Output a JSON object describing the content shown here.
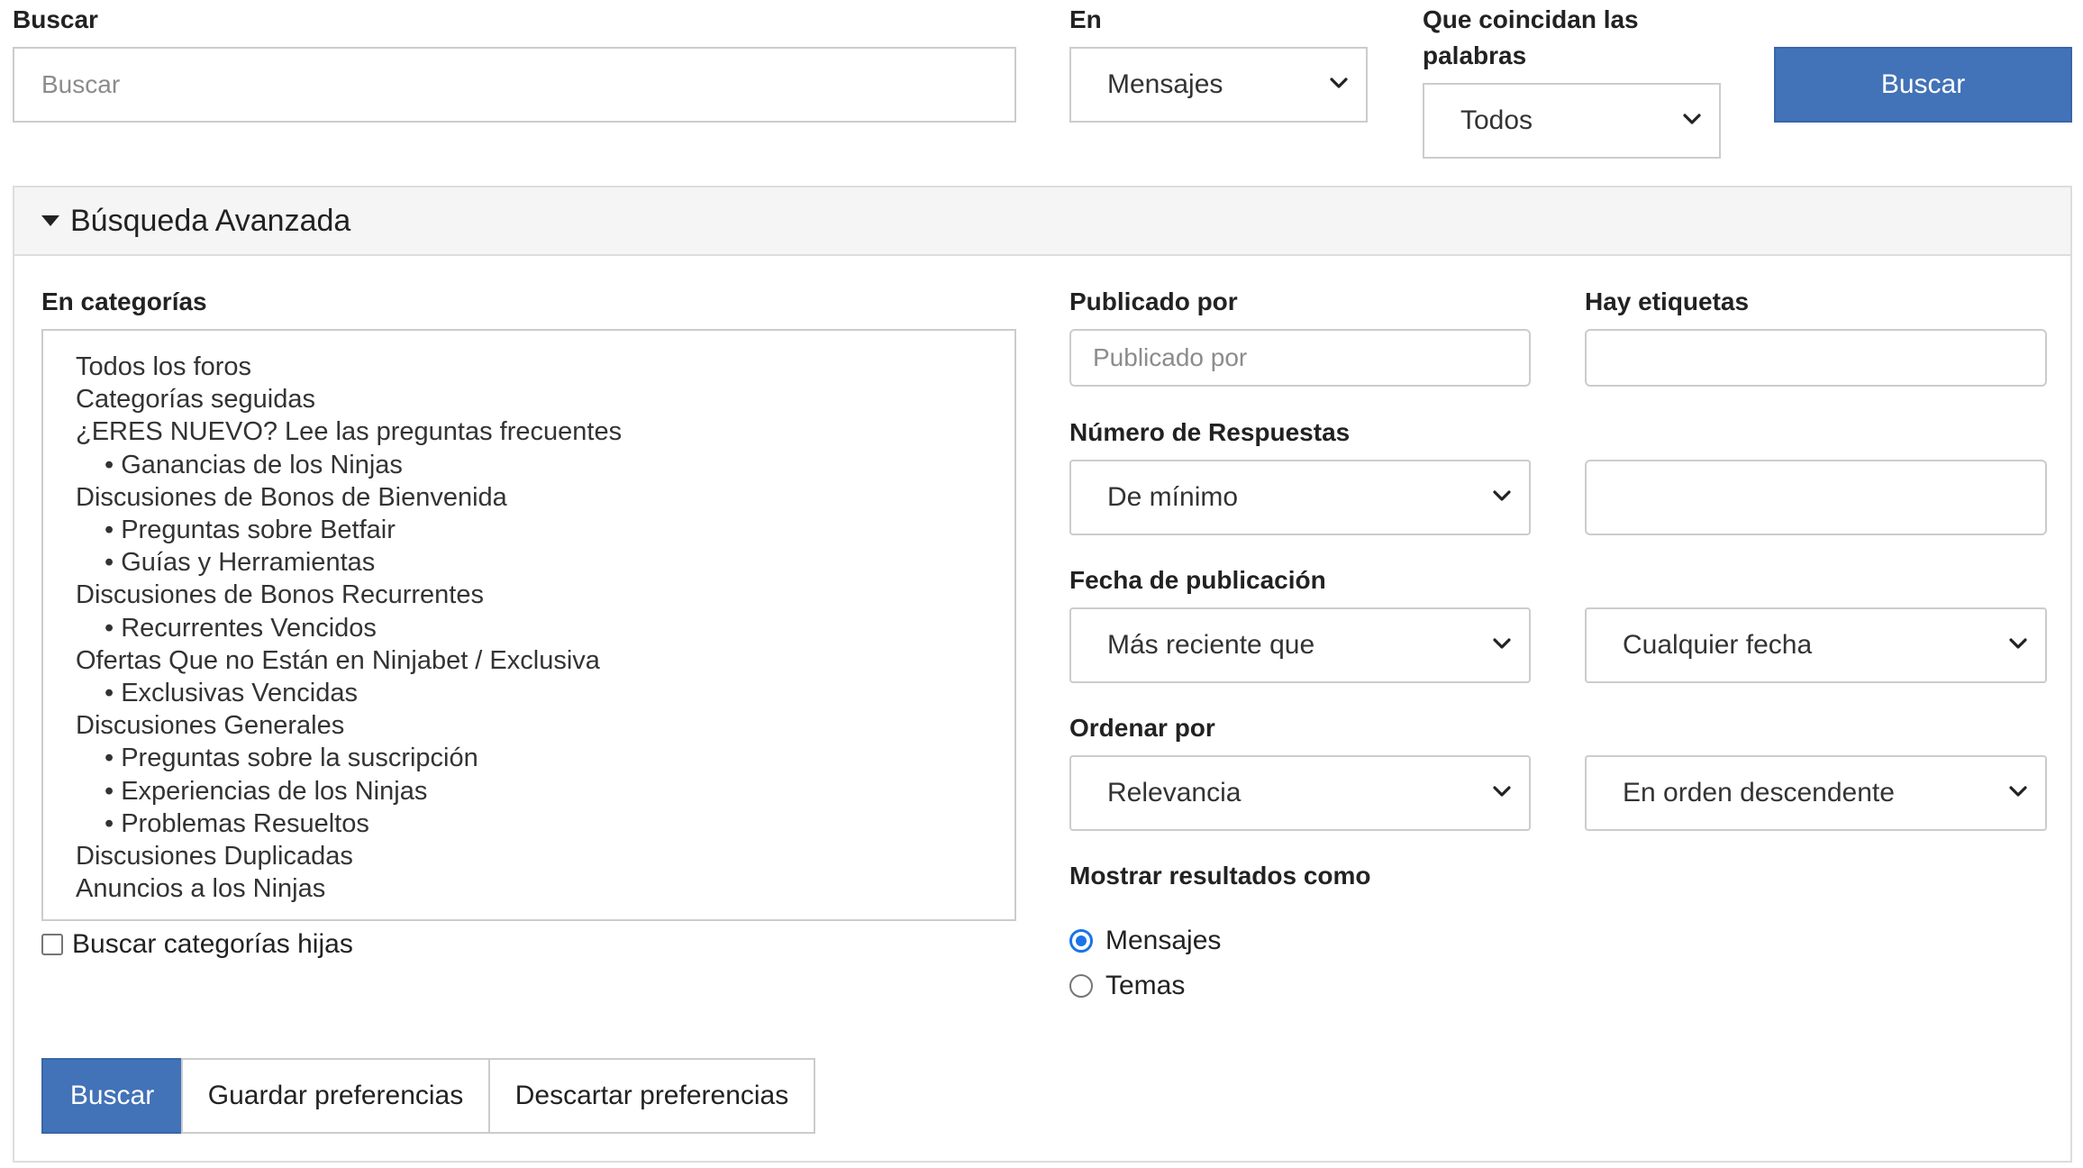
{
  "top": {
    "search_label": "Buscar",
    "search_placeholder": "Buscar",
    "in_label": "En",
    "in_value": "Mensajes",
    "match_label_line1": "Que coincidan las",
    "match_label_line2": "palabras",
    "match_value": "Todos",
    "search_button": "Buscar"
  },
  "advanced": {
    "title": "Búsqueda Avanzada",
    "categories_label": "En categorías",
    "categories": [
      {
        "label": "Todos los foros",
        "child": false
      },
      {
        "label": "Categorías seguidas",
        "child": false
      },
      {
        "label": "¿ERES NUEVO? Lee las preguntas frecuentes",
        "child": false
      },
      {
        "label": "• Ganancias de los Ninjas",
        "child": true
      },
      {
        "label": "Discusiones de Bonos de Bienvenida",
        "child": false
      },
      {
        "label": "• Preguntas sobre Betfair",
        "child": true
      },
      {
        "label": "• Guías y Herramientas",
        "child": true
      },
      {
        "label": "Discusiones de Bonos Recurrentes",
        "child": false
      },
      {
        "label": "• Recurrentes Vencidos",
        "child": true
      },
      {
        "label": "Ofertas Que no Están en Ninjabet / Exclusiva",
        "child": false
      },
      {
        "label": "• Exclusivas Vencidas",
        "child": true
      },
      {
        "label": "Discusiones Generales",
        "child": false
      },
      {
        "label": "• Preguntas sobre la suscripción",
        "child": true
      },
      {
        "label": "• Experiencias de los Ninjas",
        "child": true
      },
      {
        "label": "• Problemas Resueltos",
        "child": true
      },
      {
        "label": "Discusiones Duplicadas",
        "child": false
      },
      {
        "label": "Anuncios a los Ninjas",
        "child": false
      }
    ],
    "child_categories_checkbox": "Buscar categorías hijas",
    "posted_by_label": "Publicado por",
    "posted_by_placeholder": "Publicado por",
    "tags_label": "Hay etiquetas",
    "tags_value": "",
    "replies_label": "Número de Respuestas",
    "replies_mode": "De mínimo",
    "replies_value": "",
    "date_label": "Fecha de publicación",
    "date_mode": "Más reciente que",
    "date_value": "Cualquier fecha",
    "order_label": "Ordenar por",
    "order_by": "Relevancia",
    "order_direction": "En orden descendente",
    "show_as_label": "Mostrar resultados como",
    "show_as_options": [
      "Mensajes",
      "Temas"
    ],
    "show_as_selected": "Mensajes",
    "buttons": {
      "search": "Buscar",
      "save": "Guardar preferencias",
      "discard": "Descartar preferencias"
    }
  }
}
